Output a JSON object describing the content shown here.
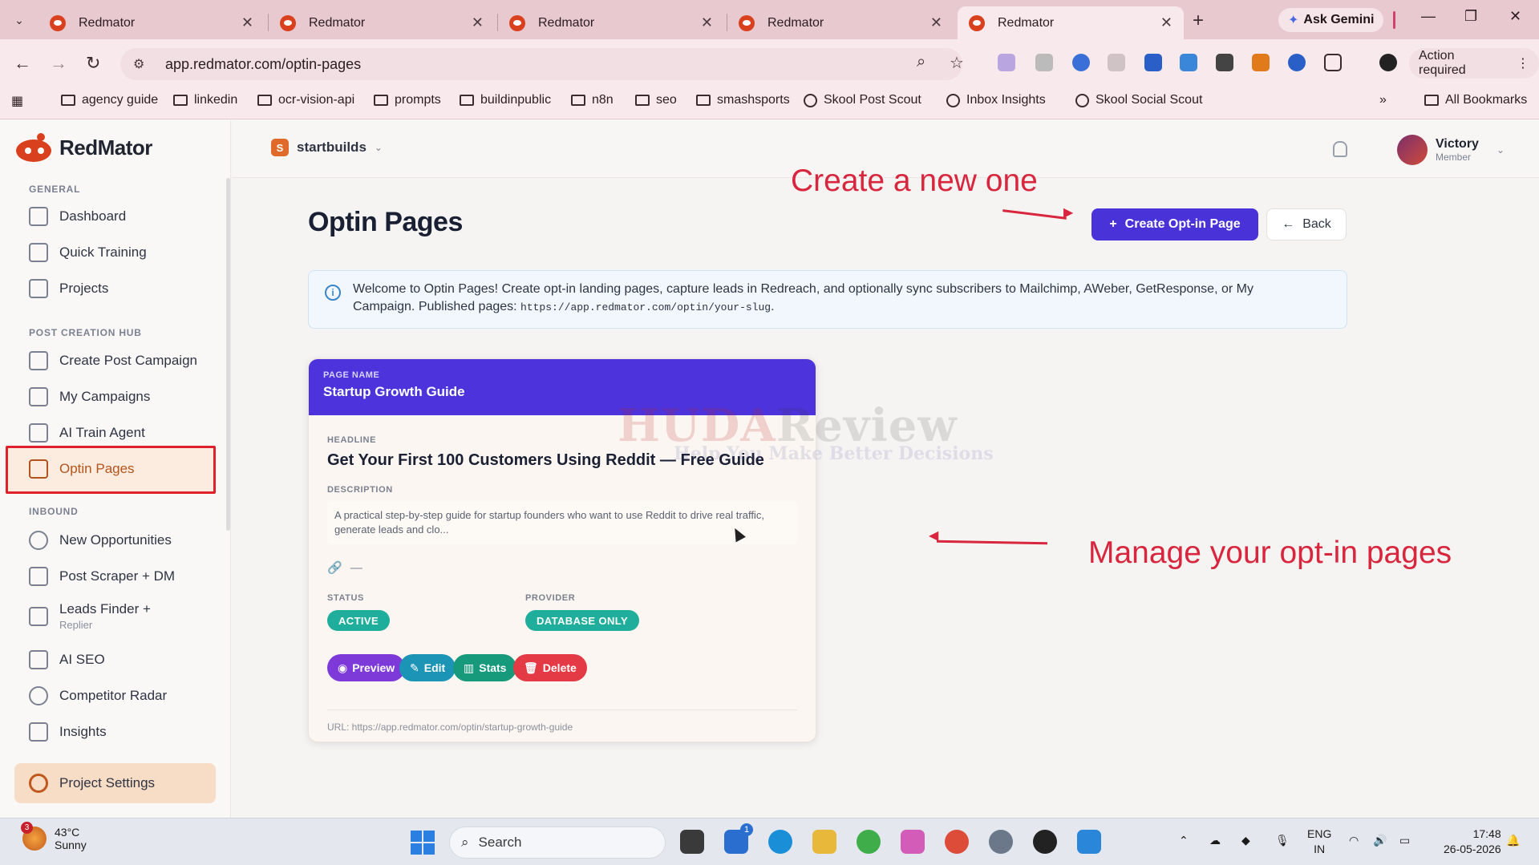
{
  "browser": {
    "tabs": [
      {
        "title": "Redmator",
        "active": false
      },
      {
        "title": "Redmator",
        "active": false
      },
      {
        "title": "Redmator",
        "active": false
      },
      {
        "title": "Redmator",
        "active": false
      },
      {
        "title": "Redmator",
        "active": true
      }
    ],
    "ask_gemini": "Ask Gemini",
    "url": "app.redmator.com/optin-pages",
    "action_required": "Action required",
    "bookmarks": [
      "agency guide",
      "linkedin",
      "ocr-vision-api",
      "prompts",
      "buildinpublic",
      "n8n",
      "seo",
      "smashsports",
      "Skool Post Scout",
      "Inbox Insights",
      "Skool Social Scout"
    ],
    "all_bookmarks": "All Bookmarks"
  },
  "app": {
    "brand": "RedMator",
    "workspace": {
      "badge": "S",
      "name": "startbuilds"
    },
    "user": {
      "name": "Victory",
      "role": "Member"
    },
    "sidebar": {
      "sections": [
        {
          "label": "GENERAL",
          "items": [
            {
              "label": "Dashboard"
            },
            {
              "label": "Quick Training"
            },
            {
              "label": "Projects"
            }
          ]
        },
        {
          "label": "POST CREATION HUB",
          "items": [
            {
              "label": "Create Post Campaign"
            },
            {
              "label": "My Campaigns"
            },
            {
              "label": "AI Train Agent"
            },
            {
              "label": "Optin Pages",
              "active": true
            }
          ]
        },
        {
          "label": "INBOUND",
          "items": [
            {
              "label": "New Opportunities"
            },
            {
              "label": "Post Scraper + DM"
            },
            {
              "label": "Leads Finder +",
              "sub": "Replier"
            },
            {
              "label": "AI SEO"
            },
            {
              "label": "Competitor Radar"
            },
            {
              "label": "Insights"
            }
          ]
        }
      ],
      "project_settings": "Project Settings"
    },
    "page": {
      "title": "Optin Pages",
      "create_button": "Create Opt-in Page",
      "back_button": "Back",
      "info_text": "Welcome to Optin Pages! Create opt-in landing pages, capture leads in Redreach, and optionally sync subscribers to Mailchimp, AWeber, GetResponse, or My Campaign. Published pages: ",
      "info_code": "https://app.redmator.com/optin/your-slug",
      "info_end": "."
    },
    "card": {
      "page_name_label": "PAGE NAME",
      "page_name": "Startup Growth Guide",
      "headline_label": "HEADLINE",
      "headline": "Get Your First 100 Customers Using Reddit — Free Guide",
      "description_label": "DESCRIPTION",
      "description": "A practical step-by-step guide for startup founders who want to use Reddit to drive real traffic, generate leads and clo...",
      "link_value": "—",
      "status_label": "STATUS",
      "status": "ACTIVE",
      "provider_label": "PROVIDER",
      "provider": "DATABASE ONLY",
      "actions": {
        "preview": "Preview",
        "edit": "Edit",
        "stats": "Stats",
        "delete": "Delete"
      },
      "url": "URL: https://app.redmator.com/optin/startup-growth-guide"
    }
  },
  "annotations": {
    "create_note": "Create a new one",
    "manage_note": "Manage your opt-in pages"
  },
  "watermark": {
    "main_red": "HUDA",
    "main_dark": "Review",
    "sub": "Help You Make Better Decisions"
  },
  "taskbar": {
    "weather_badge": "3",
    "temperature": "43°C",
    "condition": "Sunny",
    "search": "Search",
    "lang1": "ENG",
    "lang2": "IN",
    "time": "17:48",
    "date": "26-05-2026",
    "taskbar_badge": "1"
  },
  "colors": {
    "accent": "#4a32d9",
    "brand": "#d9411e",
    "status": "#1fae9b",
    "annotation": "#d7263d"
  }
}
